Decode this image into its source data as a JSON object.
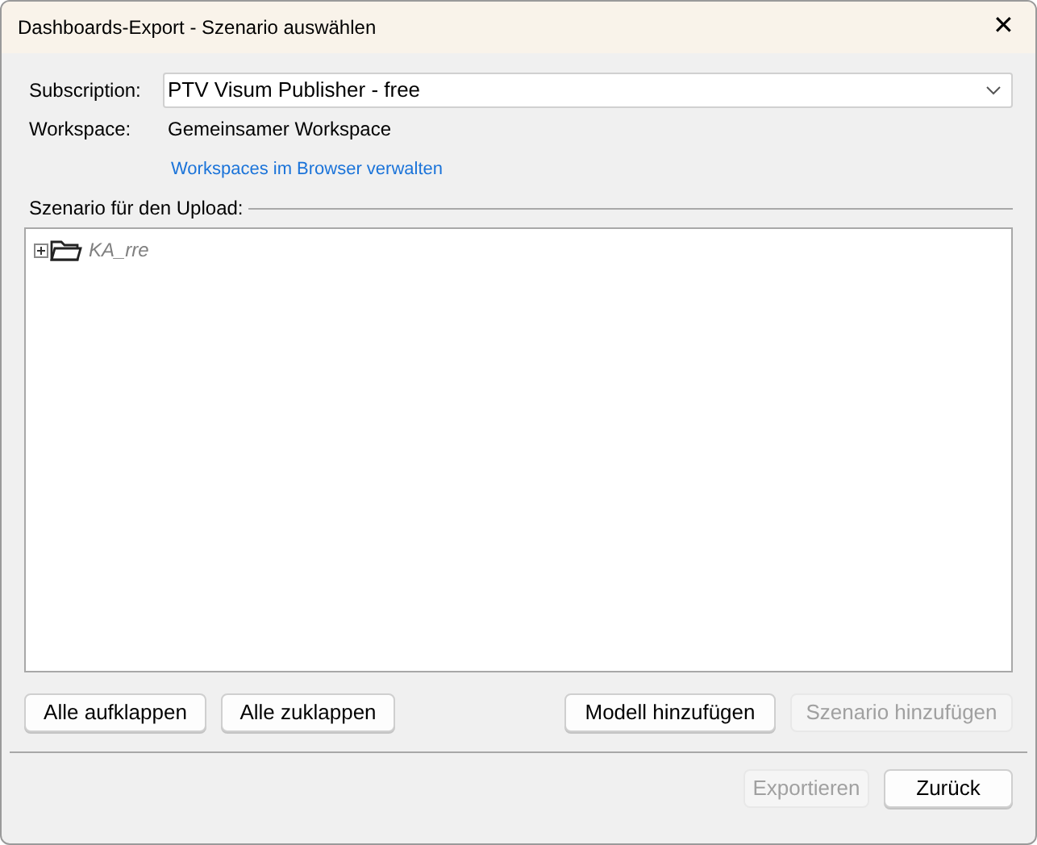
{
  "window": {
    "title": "Dashboards-Export - Szenario auswählen",
    "close": "✕"
  },
  "subscription": {
    "label": "Subscription:",
    "value": "PTV Visum Publisher - free"
  },
  "workspace": {
    "label": "Workspace:",
    "value": "Gemeinsamer Workspace",
    "link": "Workspaces im Browser verwalten"
  },
  "scenario_group": {
    "label": "Szenario für den Upload:"
  },
  "tree": [
    {
      "label": "KA_rre",
      "expanded": false,
      "disabled": true
    }
  ],
  "action_buttons": [
    {
      "label": "Alle aufklappen",
      "disabled": false
    },
    {
      "label": "Alle zuklappen",
      "disabled": false
    },
    {
      "label": "Modell hinzufügen",
      "disabled": false
    },
    {
      "label": "Szenario hinzufügen",
      "disabled": true
    }
  ],
  "footer_buttons": [
    {
      "label": "Exportieren",
      "disabled": true
    },
    {
      "label": "Zurück",
      "disabled": false
    }
  ]
}
